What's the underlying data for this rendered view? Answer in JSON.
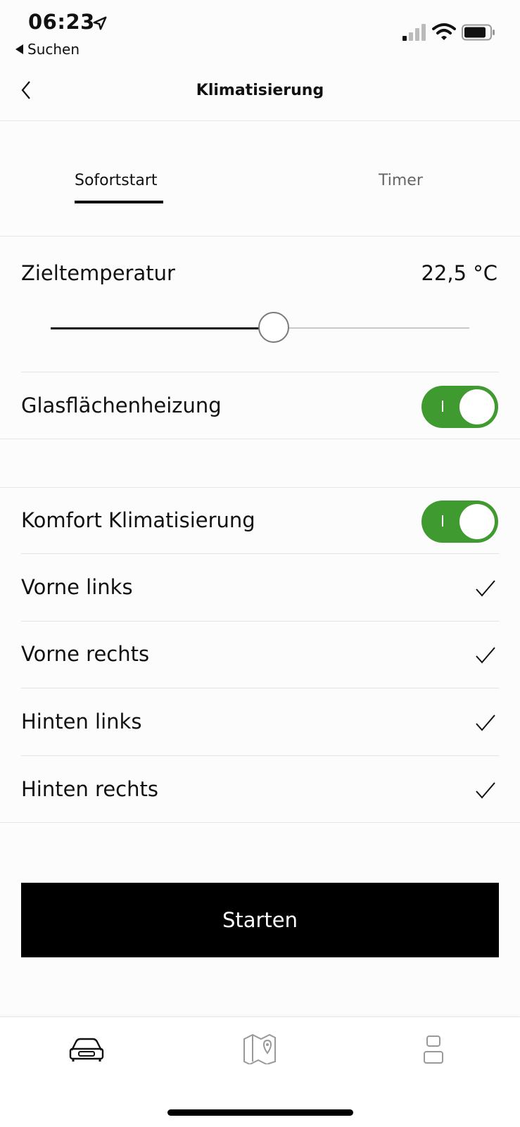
{
  "status_bar": {
    "time": "06:23",
    "back_app_label": "Suchen"
  },
  "nav": {
    "title": "Klimatisierung"
  },
  "tabs": [
    {
      "label": "Sofortstart",
      "active": true
    },
    {
      "label": "Timer",
      "active": false
    }
  ],
  "target_temperature": {
    "label": "Zieltemperatur",
    "value": "22,5 °C",
    "slider_fraction": 0.53
  },
  "window_heating": {
    "label": "Glasflächenheizung",
    "enabled": true
  },
  "comfort": {
    "label": "Komfort Klimatisierung",
    "enabled": true,
    "seats": [
      {
        "label": "Vorne links",
        "checked": true
      },
      {
        "label": "Vorne rechts",
        "checked": true
      },
      {
        "label": "Hinten links",
        "checked": true
      },
      {
        "label": "Hinten rechts",
        "checked": true
      }
    ]
  },
  "start_button": {
    "label": "Starten"
  },
  "tab_bar": {
    "items": [
      {
        "icon": "car-icon",
        "active": true
      },
      {
        "icon": "map-icon",
        "active": false
      },
      {
        "icon": "profile-icon",
        "active": false
      }
    ]
  },
  "colors": {
    "toggle_on": "#3f9a2f",
    "accent": "#000000",
    "inactive_tab": "#666666"
  }
}
